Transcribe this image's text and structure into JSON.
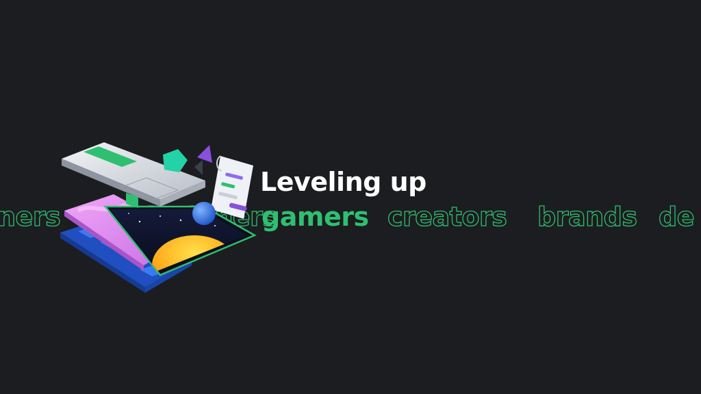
{
  "hero": {
    "headline": "Leveling up",
    "words": {
      "left_fragment": "ners",
      "hidden": "designers",
      "active": "gamers",
      "next_1": "creators",
      "next_2": "brands",
      "next_3_fragment": "de"
    }
  },
  "colors": {
    "background": "#1c1d20",
    "headline": "#ffffff",
    "accent_green": "#2fbf71",
    "illustration_pink": "#e28af0",
    "illustration_blue": "#2f6fe0",
    "illustration_sun": "#ffb020",
    "illustration_violet": "#8a4fe0",
    "illustration_teal": "#24d2a8"
  },
  "illustration": {
    "name": "isometric-stacked-devices-illustration",
    "icons": [
      "laptop-panel-icon",
      "tablet-sunrise-screen-icon",
      "chat-document-icon",
      "blue-sphere-icon",
      "teal-gem-icon",
      "violet-pyramid-icon"
    ]
  }
}
